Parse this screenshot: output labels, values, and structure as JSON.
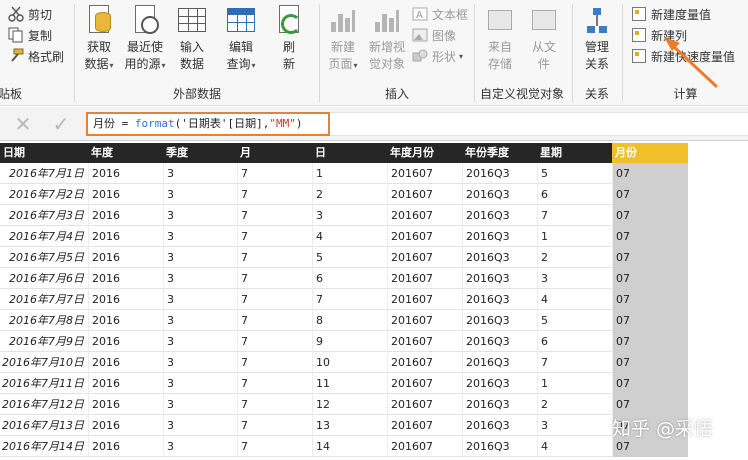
{
  "ribbon": {
    "clipboard": {
      "cut": "剪切",
      "copy": "复制",
      "format_painter": "格式刷",
      "group_label": "剪贴板"
    },
    "external_data": {
      "get_data": [
        "获取",
        "数据"
      ],
      "recent_sources": [
        "最近使",
        "用的源"
      ],
      "enter_data": [
        "输入",
        "数据"
      ],
      "edit_queries": [
        "编辑",
        "查询"
      ],
      "refresh": [
        "刷",
        "新"
      ],
      "group_label": "外部数据"
    },
    "insert": {
      "new_page": [
        "新建",
        "页面"
      ],
      "new_visual": [
        "新增视",
        "觉对象"
      ],
      "textbox": "文本框",
      "image": "图像",
      "shapes": "形状",
      "group_label": "插入"
    },
    "custom_visuals": {
      "from_store": [
        "来自",
        "存储"
      ],
      "from_file": [
        "从文",
        "件"
      ],
      "group_label": "自定义视觉对象"
    },
    "relationships": {
      "manage": [
        "管理",
        "关系"
      ],
      "group_label": "关系"
    },
    "calculations": {
      "new_measure": "新建度量值",
      "new_column": "新建列",
      "new_quick_measure": "新建快速度量值",
      "group_label": "计算"
    }
  },
  "formula_bar": {
    "cancel_glyph": "✕",
    "confirm_glyph": "✓",
    "formula": {
      "lhs": "月份 = ",
      "fn": "format",
      "arg1": "('日期表'[日期],",
      "arg2": "\"MM\"",
      "close": ")"
    }
  },
  "table": {
    "columns": [
      "日期",
      "年度",
      "季度",
      "月",
      "日",
      "年度月份",
      "年份季度",
      "星期",
      "月份"
    ],
    "rows": [
      [
        "2016年7月1日",
        "2016",
        "3",
        "7",
        "1",
        "201607",
        "2016Q3",
        "5",
        "07"
      ],
      [
        "2016年7月2日",
        "2016",
        "3",
        "7",
        "2",
        "201607",
        "2016Q3",
        "6",
        "07"
      ],
      [
        "2016年7月3日",
        "2016",
        "3",
        "7",
        "3",
        "201607",
        "2016Q3",
        "7",
        "07"
      ],
      [
        "2016年7月4日",
        "2016",
        "3",
        "7",
        "4",
        "201607",
        "2016Q3",
        "1",
        "07"
      ],
      [
        "2016年7月5日",
        "2016",
        "3",
        "7",
        "5",
        "201607",
        "2016Q3",
        "2",
        "07"
      ],
      [
        "2016年7月6日",
        "2016",
        "3",
        "7",
        "6",
        "201607",
        "2016Q3",
        "3",
        "07"
      ],
      [
        "2016年7月7日",
        "2016",
        "3",
        "7",
        "7",
        "201607",
        "2016Q3",
        "4",
        "07"
      ],
      [
        "2016年7月8日",
        "2016",
        "3",
        "7",
        "8",
        "201607",
        "2016Q3",
        "5",
        "07"
      ],
      [
        "2016年7月9日",
        "2016",
        "3",
        "7",
        "9",
        "201607",
        "2016Q3",
        "6",
        "07"
      ],
      [
        "2016年7月10日",
        "2016",
        "3",
        "7",
        "10",
        "201607",
        "2016Q3",
        "7",
        "07"
      ],
      [
        "2016年7月11日",
        "2016",
        "3",
        "7",
        "11",
        "201607",
        "2016Q3",
        "1",
        "07"
      ],
      [
        "2016年7月12日",
        "2016",
        "3",
        "7",
        "12",
        "201607",
        "2016Q3",
        "2",
        "07"
      ],
      [
        "2016年7月13日",
        "2016",
        "3",
        "7",
        "13",
        "201607",
        "2016Q3",
        "3",
        "07"
      ],
      [
        "2016年7月14日",
        "2016",
        "3",
        "7",
        "14",
        "201607",
        "2016Q3",
        "4",
        "07"
      ]
    ]
  },
  "watermark": "知乎 @采悟",
  "colors": {
    "header_bg": "#262626",
    "highlight_header": "#f0c02a",
    "selected_cells": "#cfcfcf",
    "formula_outline": "#e0843a",
    "annotation_arrow": "#f07a28"
  }
}
